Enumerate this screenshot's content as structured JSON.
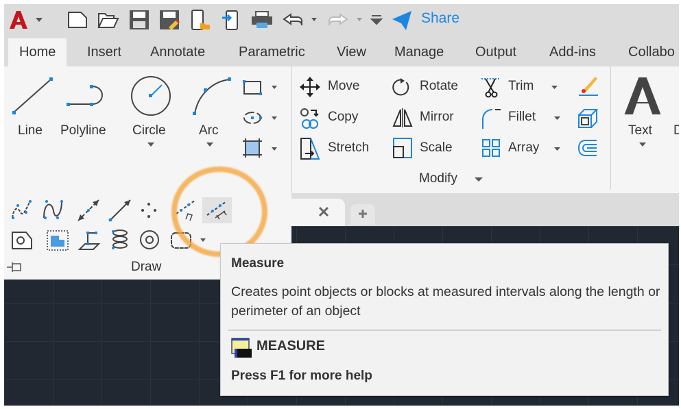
{
  "quick_access": {
    "share_label": "Share",
    "icons": [
      "autocad-logo",
      "new-icon",
      "open-icon",
      "save-icon",
      "save-as-icon",
      "open-web-mobile-icon",
      "save-web-mobile-icon",
      "plot-icon",
      "undo-icon",
      "redo-icon",
      "customize-icon",
      "share-icon"
    ]
  },
  "tabs": [
    "Home",
    "Insert",
    "Annotate",
    "Parametric",
    "View",
    "Manage",
    "Output",
    "Add-ins",
    "Collabo"
  ],
  "draw": {
    "title": "Draw",
    "line": "Line",
    "polyline": "Polyline",
    "circle": "Circle",
    "arc": "Arc"
  },
  "modify": {
    "title": "Modify",
    "move": "Move",
    "rotate": "Rotate",
    "trim": "Trim",
    "copy": "Copy",
    "mirror": "Mirror",
    "fillet": "Fillet",
    "stretch": "Stretch",
    "scale": "Scale",
    "array": "Array"
  },
  "annotation": {
    "text": "Text",
    "next": "D"
  },
  "tooltip": {
    "title": "Measure",
    "description": "Creates point objects or blocks at measured intervals along the length or perimeter of an object",
    "command": "MEASURE",
    "help": "Press F1 for more help"
  },
  "colors": {
    "accent": "#1b87e0",
    "highlight": "#f5a032",
    "canvas": "#212832"
  }
}
